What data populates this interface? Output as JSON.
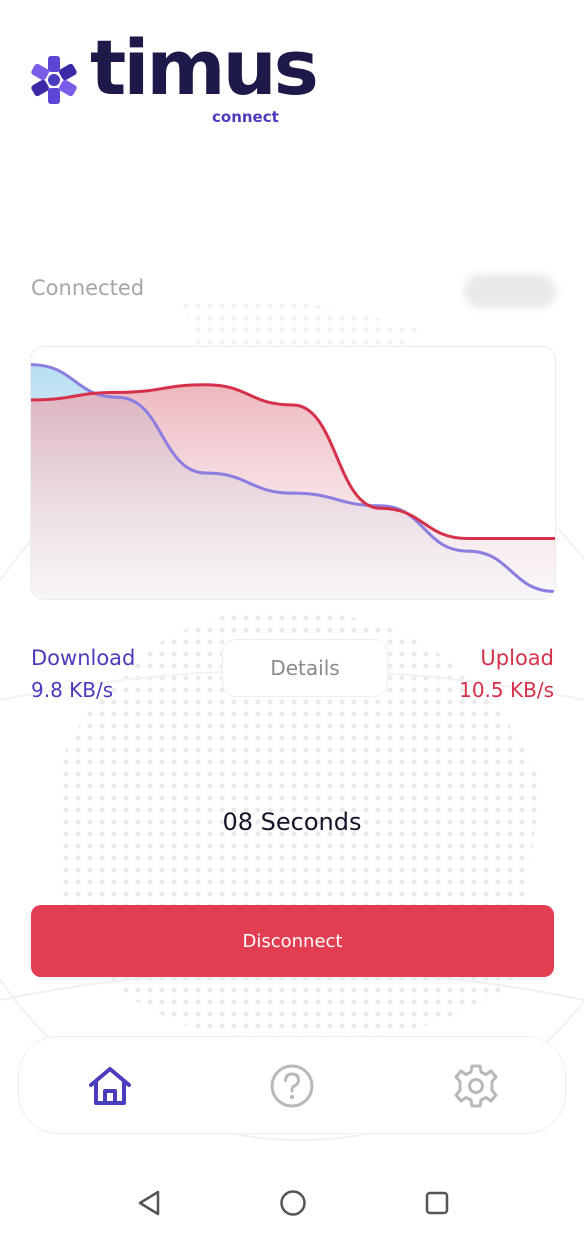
{
  "app": {
    "logo_word": "timus",
    "logo_sub": "connect"
  },
  "status": {
    "text": "Connected"
  },
  "traffic_chart": {
    "type": "area",
    "series": [
      {
        "key": "download",
        "color": "#5b46d6",
        "values": [
          0.93,
          0.8,
          0.5,
          0.42,
          0.37,
          0.19,
          0.03
        ]
      },
      {
        "key": "upload",
        "color": "#d6314a",
        "values": [
          0.79,
          0.82,
          0.85,
          0.77,
          0.36,
          0.24,
          0.24
        ]
      }
    ],
    "y_range": [
      0,
      1
    ]
  },
  "stats": {
    "download_label": "Download",
    "download_value": "9.8 KB/s",
    "upload_label": "Upload",
    "upload_value": "10.5 KB/s"
  },
  "details_button": {
    "label": "Details"
  },
  "timer": {
    "text": "08 Seconds"
  },
  "disconnect_button": {
    "label": "Disconnect"
  },
  "bottom_nav": {
    "items": [
      {
        "icon": "home-icon",
        "active": true,
        "color": "#4b3bbd"
      },
      {
        "icon": "help-icon",
        "active": false,
        "color": "#b8b8b8"
      },
      {
        "icon": "gear-icon",
        "active": false,
        "color": "#b8b8b8"
      }
    ]
  },
  "system_nav": [
    "back-icon",
    "home-circle-icon",
    "recent-apps-icon"
  ],
  "colors": {
    "brand": "#1d1a4a",
    "accent": "#4b3bbd",
    "danger": "#e23d50"
  }
}
